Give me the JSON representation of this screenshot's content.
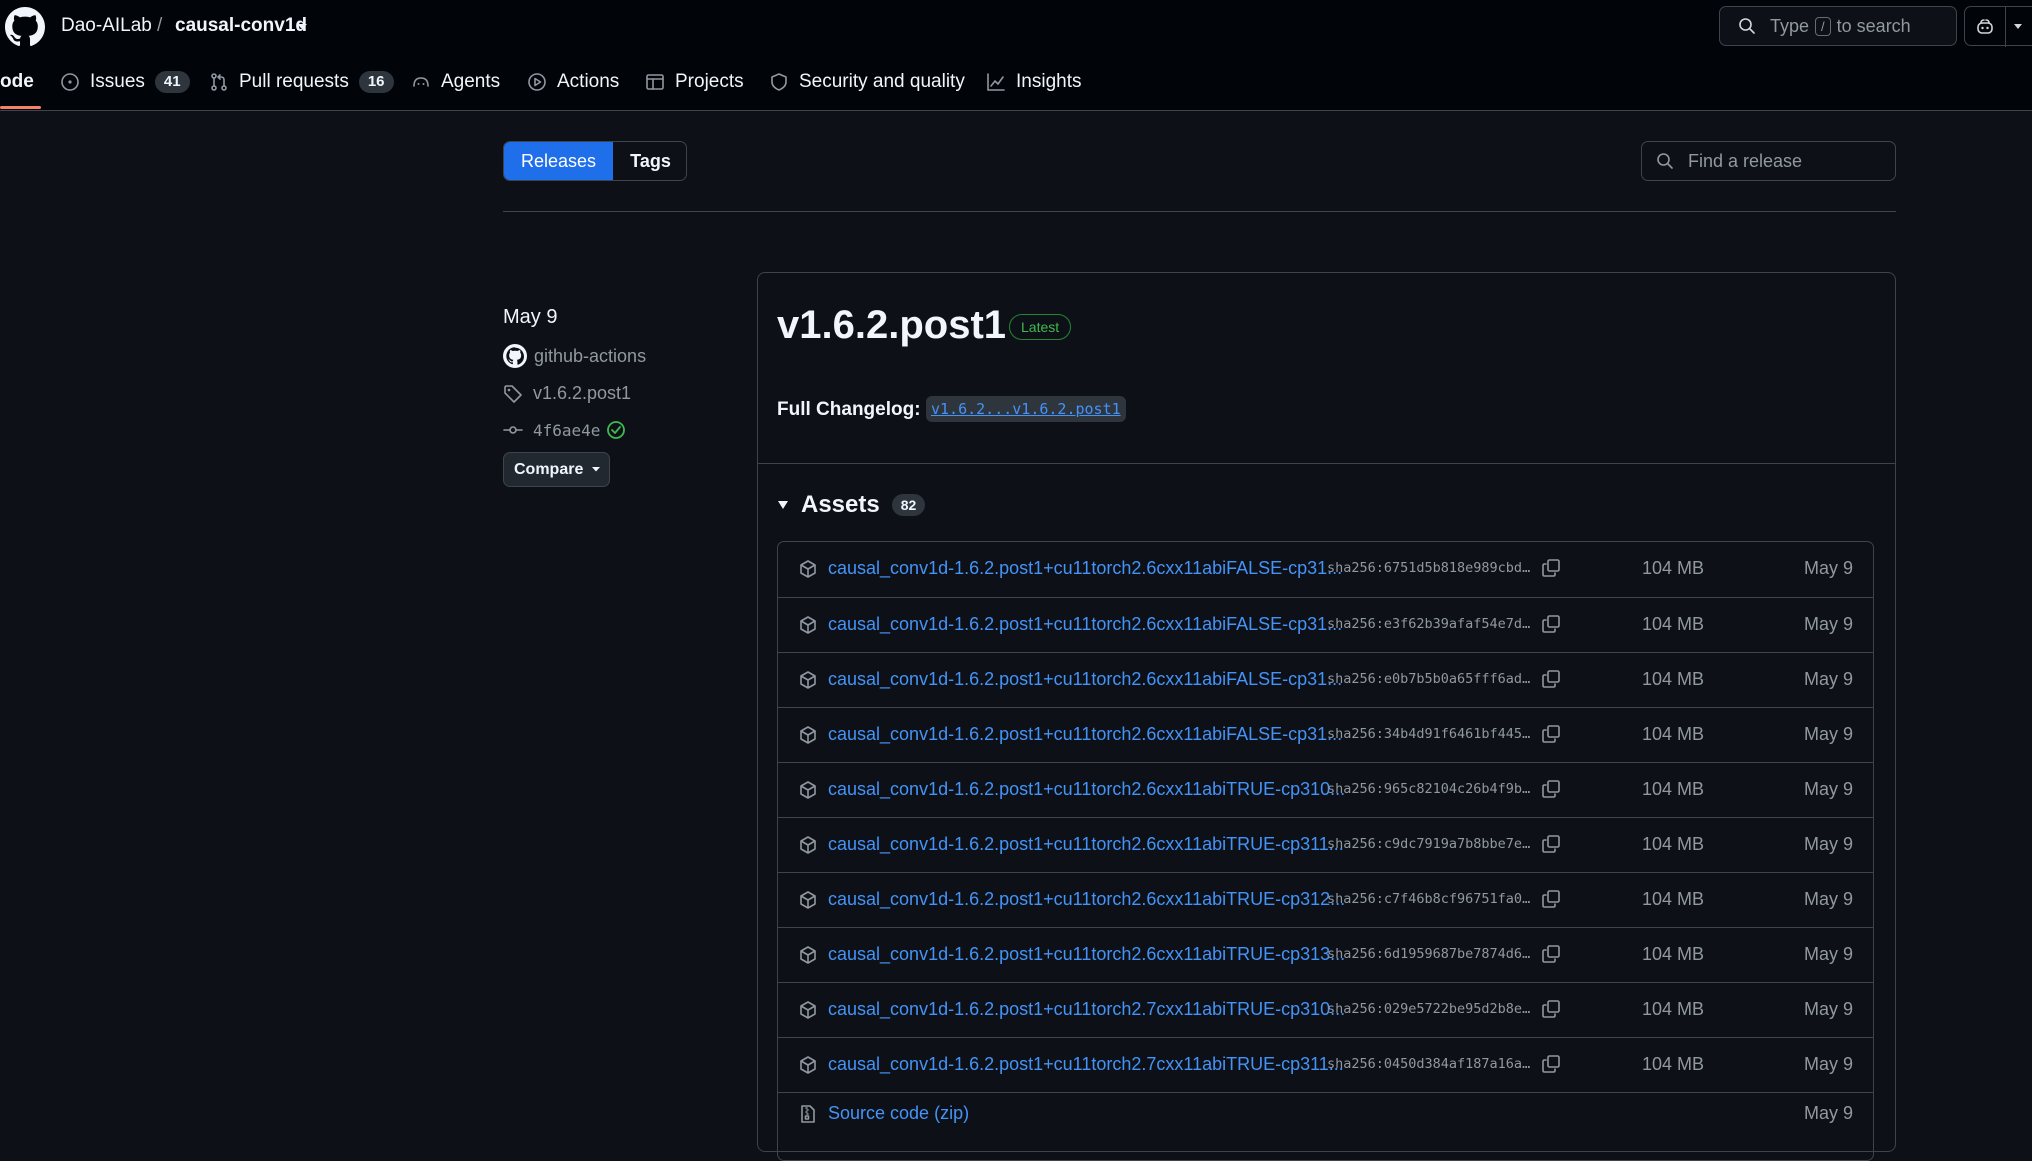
{
  "header": {
    "owner": "Dao-AILab",
    "separator": "/",
    "repo": "causal-conv1d",
    "search_prefix": "Type",
    "search_key": "/",
    "search_suffix": "to search"
  },
  "nav": {
    "code": "ode",
    "issues": "Issues",
    "issues_count": "41",
    "pulls": "Pull requests",
    "pulls_count": "16",
    "agents": "Agents",
    "actions": "Actions",
    "projects": "Projects",
    "security": "Security and quality",
    "insights": "Insights"
  },
  "tabs": {
    "releases": "Releases",
    "tags": "Tags"
  },
  "find_release_placeholder": "Find a release",
  "sidebar": {
    "date": "May 9",
    "author": "github-actions",
    "tag": "v1.6.2.post1",
    "commit": "4f6ae4e",
    "compare": "Compare"
  },
  "release": {
    "title": "v1.6.2.post1",
    "badge": "Latest",
    "changelog_label": "Full Changelog:",
    "changelog_link": "v1.6.2...v1.6.2.post1",
    "assets_label": "Assets",
    "assets_count": "82"
  },
  "assets": [
    {
      "name": "causal_conv1d-1.6.2.post1+cu11torch2.6cxx11abiFALSE-cp31...",
      "sha": "sha256:6751d5b818e989cbd…",
      "size": "104 MB",
      "date": "May 9"
    },
    {
      "name": "causal_conv1d-1.6.2.post1+cu11torch2.6cxx11abiFALSE-cp31...",
      "sha": "sha256:e3f62b39afaf54e7d…",
      "size": "104 MB",
      "date": "May 9"
    },
    {
      "name": "causal_conv1d-1.6.2.post1+cu11torch2.6cxx11abiFALSE-cp31...",
      "sha": "sha256:e0b7b5b0a65fff6ad…",
      "size": "104 MB",
      "date": "May 9"
    },
    {
      "name": "causal_conv1d-1.6.2.post1+cu11torch2.6cxx11abiFALSE-cp31...",
      "sha": "sha256:34b4d91f6461bf445…",
      "size": "104 MB",
      "date": "May 9"
    },
    {
      "name": "causal_conv1d-1.6.2.post1+cu11torch2.6cxx11abiTRUE-cp310...",
      "sha": "sha256:965c82104c26b4f9b…",
      "size": "104 MB",
      "date": "May 9"
    },
    {
      "name": "causal_conv1d-1.6.2.post1+cu11torch2.6cxx11abiTRUE-cp311...",
      "sha": "sha256:c9dc7919a7b8bbe7e…",
      "size": "104 MB",
      "date": "May 9"
    },
    {
      "name": "causal_conv1d-1.6.2.post1+cu11torch2.6cxx11abiTRUE-cp312...",
      "sha": "sha256:c7f46b8cf96751fa0…",
      "size": "104 MB",
      "date": "May 9"
    },
    {
      "name": "causal_conv1d-1.6.2.post1+cu11torch2.6cxx11abiTRUE-cp313...",
      "sha": "sha256:6d1959687be7874d6…",
      "size": "104 MB",
      "date": "May 9"
    },
    {
      "name": "causal_conv1d-1.6.2.post1+cu11torch2.7cxx11abiTRUE-cp310...",
      "sha": "sha256:029e5722be95d2b8e…",
      "size": "104 MB",
      "date": "May 9"
    },
    {
      "name": "causal_conv1d-1.6.2.post1+cu11torch2.7cxx11abiTRUE-cp311...",
      "sha": "sha256:0450d384af187a16a…",
      "size": "104 MB",
      "date": "May 9"
    }
  ],
  "source_code": {
    "label": "Source code",
    "format": "(zip)",
    "date": "May 9"
  }
}
